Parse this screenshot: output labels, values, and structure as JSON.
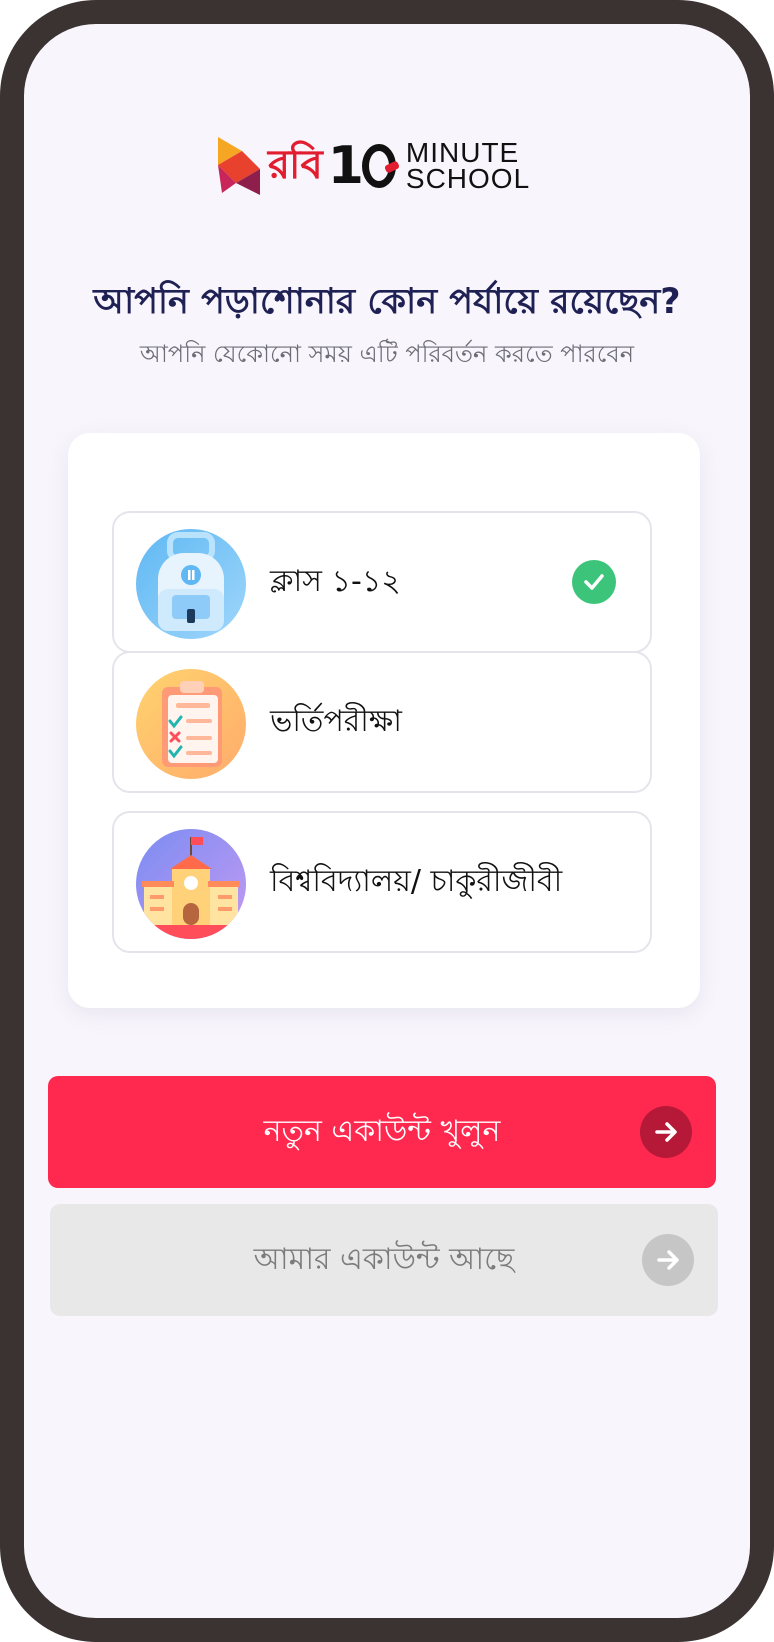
{
  "brand": {
    "robi_text": "রবি",
    "ten_one": "1",
    "ten_zero": "0",
    "minute_text": "MINUTE",
    "school_text": "SCHOOL"
  },
  "heading": {
    "title": "আপনি পড়াশোনার কোন পর্যায়ে রয়েছেন?",
    "subtitle": "আপনি যেকোনো সময় এটি পরিবর্তন করতে পারবেন"
  },
  "options": [
    {
      "label": "ক্লাস ১-১২",
      "icon": "backpack-icon",
      "selected": true
    },
    {
      "label": "ভর্তিপরীক্ষা",
      "icon": "exam-clipboard-icon",
      "selected": false
    },
    {
      "label": "বিশ্ববিদ্যালয়/ চাকুরীজীবী",
      "icon": "university-building-icon",
      "selected": false
    }
  ],
  "buttons": {
    "create_account": "নতুন একাউন্ট খুলুন",
    "have_account": "আমার একাউন্ট আছে"
  },
  "colors": {
    "primary": "#ff284e",
    "check": "#3cc57a",
    "heading": "#1f2154",
    "phone_frame": "#3b3232",
    "background": "#f8f6fc"
  }
}
